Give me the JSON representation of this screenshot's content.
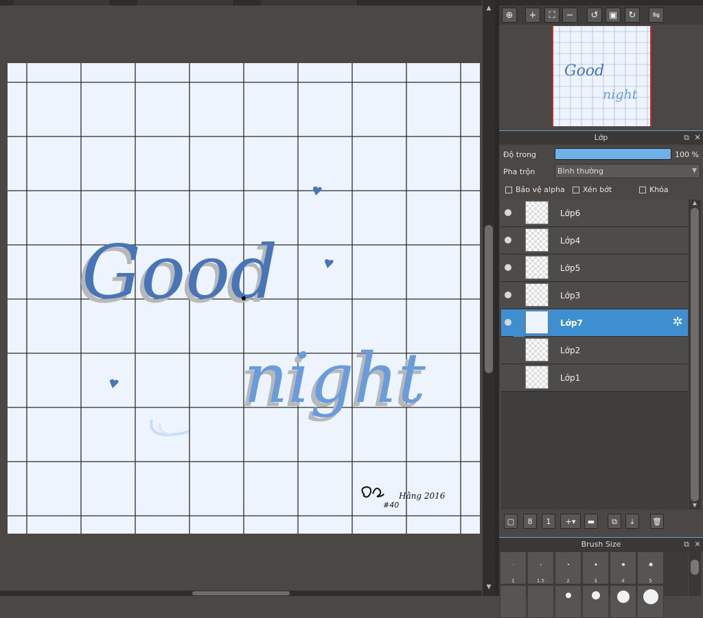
{
  "colors": {
    "accent": "#3f8fd0",
    "canvas_bg": "#eef4fd",
    "ink_blue": "#4a74b8",
    "ink_light": "#6a9bdc",
    "shadow_gray": "#b8b8b8",
    "opacity_fill": "#6db1e8"
  },
  "layers_panel": {
    "title": "Lớp",
    "opacity_label": "Độ trong",
    "opacity_value": "100 %",
    "opacity_percent": 100,
    "blend_label": "Pha trộn",
    "blend_value": "Bình thường",
    "protect_alpha_label": "Bảo vệ alpha",
    "clipping_label": "Xén bớt",
    "lock_label": "Khóa",
    "layers": [
      {
        "name": "Lớp6",
        "visible": true,
        "selected": false
      },
      {
        "name": "Lớp4",
        "visible": true,
        "selected": false
      },
      {
        "name": "Lớp5",
        "visible": true,
        "selected": false
      },
      {
        "name": "Lớp3",
        "visible": true,
        "selected": false
      },
      {
        "name": "Lớp7",
        "visible": true,
        "selected": true
      },
      {
        "name": "Lớp2",
        "visible": false,
        "selected": false
      },
      {
        "name": "Lớp1",
        "visible": false,
        "selected": false
      }
    ]
  },
  "brush_panel": {
    "title": "Brush Size",
    "sizes": [
      "1",
      "1.5",
      "2",
      "3",
      "4",
      "5"
    ]
  },
  "artwork": {
    "word1": "Good",
    "word2": "night",
    "signature": "Hằng 2016",
    "number": "#40"
  },
  "icons": {
    "nav_toolbar": [
      "zoom-fit-icon",
      "zoom-in-icon",
      "fit-window-icon",
      "zoom-out-icon",
      "rotate-left-icon",
      "reset-view-icon",
      "rotate-right-icon",
      "flip-icon"
    ],
    "layer_toolbar": [
      "new-layer-icon",
      "new-8bit-layer-icon",
      "new-1bit-layer-icon",
      "add-layer-dropdown-icon",
      "new-folder-icon",
      "duplicate-layer-icon",
      "merge-layer-icon",
      "delete-layer-icon"
    ]
  }
}
